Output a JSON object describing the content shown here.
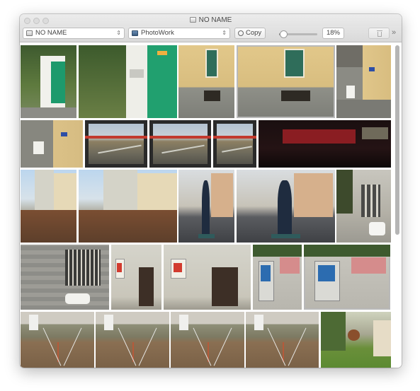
{
  "window": {
    "title": "NO NAME"
  },
  "toolbar": {
    "source_device": "NO NAME",
    "import_to": "PhotoWork",
    "copy_label": "Copy",
    "zoom_level": "18%",
    "zoom_fraction": 0.12
  },
  "more_glyph": "»",
  "photos": [
    {
      "kind": "wall-door"
    },
    {
      "kind": "wall-door-sign"
    },
    {
      "kind": "facade-window"
    },
    {
      "kind": "facade-window"
    },
    {
      "kind": "wall-sign"
    },
    {
      "kind": "wall-corner"
    },
    {
      "kind": "train-window"
    },
    {
      "kind": "train-window"
    },
    {
      "kind": "train-window"
    },
    {
      "kind": "train-dark"
    },
    {
      "kind": "building-trees"
    },
    {
      "kind": "building-trees"
    },
    {
      "kind": "statue"
    },
    {
      "kind": "statue"
    },
    {
      "kind": "building-scooter"
    },
    {
      "kind": "building-stone"
    },
    {
      "kind": "poster-wall"
    },
    {
      "kind": "poster-wall"
    },
    {
      "kind": "machine"
    },
    {
      "kind": "machine"
    },
    {
      "kind": "tripod-field"
    },
    {
      "kind": "tripod-field"
    },
    {
      "kind": "tripod-field"
    },
    {
      "kind": "tripod-field"
    },
    {
      "kind": "garden-tree"
    }
  ]
}
